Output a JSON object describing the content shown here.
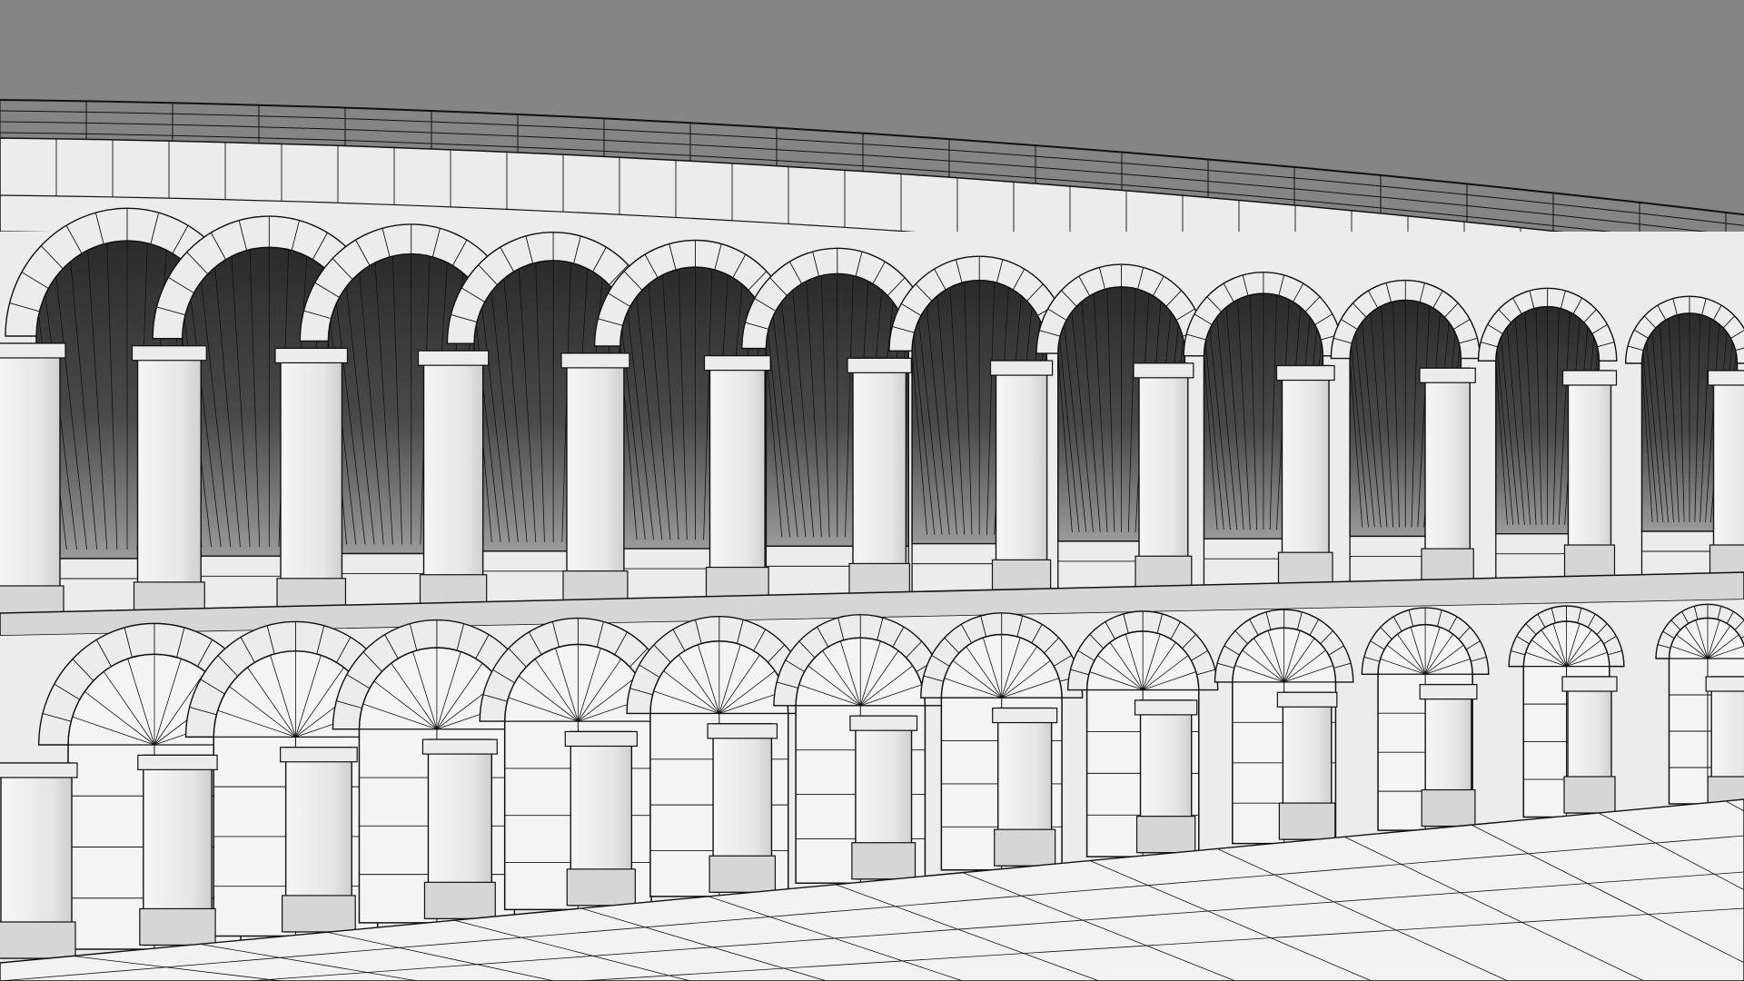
{
  "render": {
    "subject": "arena-facade-wireframe",
    "upper_tier_arch_count": 12,
    "lower_tier_arch_count": 12,
    "colors": {
      "sky": "#858585",
      "stone": "#ececec",
      "stone_shadow": "#d6d6d6",
      "arch_interior_light": "#8a8a8a",
      "arch_interior_dark": "#2c2c2c",
      "door_panel": "#f4f4f4",
      "ground": "#f2f2f2",
      "wire": "#111111"
    }
  }
}
